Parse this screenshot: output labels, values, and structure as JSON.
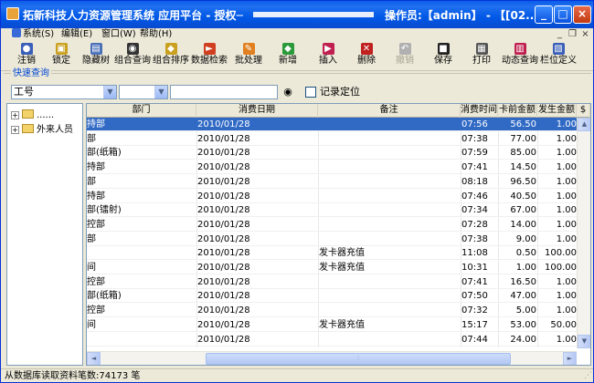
{
  "titlebar": {
    "title": "拓新科技人力资源管理系统 应用平台  - 授权─",
    "operator": "操作员:【admin】 - 【[02...",
    "controls": {
      "minimize": "_",
      "maximize": "□",
      "close": "×"
    }
  },
  "menubar": {
    "items": [
      {
        "label": "系统(S)"
      },
      {
        "label": "编辑(E)"
      },
      {
        "label": "窗口(W)"
      },
      {
        "label": "帮助(H)"
      }
    ],
    "mdi": {
      "minimize": "_",
      "restore": "❐",
      "close": "×"
    }
  },
  "toolbar": {
    "items": [
      {
        "label": "注销",
        "icon": "logout-icon",
        "glyph": "●",
        "color": "#3a5fb8"
      },
      {
        "label": "锁定",
        "icon": "lock-icon",
        "glyph": "▣",
        "color": "#c9a020"
      },
      {
        "label": "隐藏树",
        "icon": "hide-tree-icon",
        "glyph": "▤",
        "color": "#4a70b8"
      },
      {
        "label": "组合查询",
        "icon": "binoculars-icon",
        "glyph": "◉",
        "color": "#333333"
      },
      {
        "label": "组合排序",
        "icon": "sort-icon",
        "glyph": "◆",
        "color": "#c9a020"
      },
      {
        "label": "数据检索",
        "icon": "data-search-icon",
        "glyph": "►",
        "color": "#d04020"
      },
      {
        "label": "批处理",
        "icon": "batch-icon",
        "glyph": "✎",
        "color": "#e08020"
      },
      {
        "label": "新增",
        "icon": "add-icon",
        "glyph": "◆",
        "color": "#2a9a3a"
      },
      {
        "label": "插入",
        "icon": "insert-icon",
        "glyph": "▶",
        "color": "#c02050"
      },
      {
        "label": "删除",
        "icon": "delete-icon",
        "glyph": "✕",
        "color": "#c02020"
      },
      {
        "label": "撤销",
        "icon": "undo-icon",
        "glyph": "↶",
        "color": "#b0b0b0",
        "disabled": true
      },
      {
        "label": "保存",
        "icon": "save-icon",
        "glyph": "■",
        "color": "#222222"
      },
      {
        "label": "打印",
        "icon": "print-icon",
        "glyph": "▦",
        "color": "#555555"
      },
      {
        "label": "动态查询",
        "icon": "dynamic-query-icon",
        "glyph": "▥",
        "color": "#c02050"
      },
      {
        "label": "栏位定义",
        "icon": "column-define-icon",
        "glyph": "▧",
        "color": "#3a5fb8"
      }
    ]
  },
  "quick_query": {
    "legend": "快速查询",
    "field_select": "工号",
    "operator_select": "",
    "search_value": "",
    "record_locate_label": "记录定位"
  },
  "tree": {
    "nodes": [
      {
        "label": "......"
      },
      {
        "label": "外来人员"
      }
    ]
  },
  "grid": {
    "columns": {
      "dept": "部门",
      "date": "消费日期",
      "note": "备注",
      "time": "消费时间",
      "amt": "卡前金额",
      "cost": "发生金额",
      "extra": "$"
    },
    "rows": [
      {
        "dept": "持部",
        "date": "2010/01/28",
        "note": "",
        "time": "07:56",
        "amt": "56.50",
        "cost": "1.00",
        "selected": true
      },
      {
        "dept": "部",
        "date": "2010/01/28",
        "note": "",
        "time": "07:38",
        "amt": "77.00",
        "cost": "1.00"
      },
      {
        "dept": "部(纸箱)",
        "date": "2010/01/28",
        "note": "",
        "time": "07:59",
        "amt": "85.00",
        "cost": "1.00"
      },
      {
        "dept": "持部",
        "date": "2010/01/28",
        "note": "",
        "time": "07:41",
        "amt": "14.50",
        "cost": "1.00"
      },
      {
        "dept": "部",
        "date": "2010/01/28",
        "note": "",
        "time": "08:18",
        "amt": "96.50",
        "cost": "1.00"
      },
      {
        "dept": "持部",
        "date": "2010/01/28",
        "note": "",
        "time": "07:46",
        "amt": "40.50",
        "cost": "1.00"
      },
      {
        "dept": "部(镭射)",
        "date": "2010/01/28",
        "note": "",
        "time": "07:34",
        "amt": "67.00",
        "cost": "1.00"
      },
      {
        "dept": "控部",
        "date": "2010/01/28",
        "note": "",
        "time": "07:28",
        "amt": "14.00",
        "cost": "1.00"
      },
      {
        "dept": "部",
        "date": "2010/01/28",
        "note": "",
        "time": "07:38",
        "amt": "9.00",
        "cost": "1.00"
      },
      {
        "dept": "",
        "date": "2010/01/28",
        "note": "发卡器充值",
        "time": "11:08",
        "amt": "0.50",
        "cost": "100.00"
      },
      {
        "dept": "间",
        "date": "2010/01/28",
        "note": "发卡器充值",
        "time": "10:31",
        "amt": "1.00",
        "cost": "100.00"
      },
      {
        "dept": "控部",
        "date": "2010/01/28",
        "note": "",
        "time": "07:41",
        "amt": "16.50",
        "cost": "1.00"
      },
      {
        "dept": "部(纸箱)",
        "date": "2010/01/28",
        "note": "",
        "time": "07:50",
        "amt": "47.00",
        "cost": "1.00"
      },
      {
        "dept": "控部",
        "date": "2010/01/28",
        "note": "",
        "time": "07:32",
        "amt": "5.00",
        "cost": "1.00"
      },
      {
        "dept": "间",
        "date": "2010/01/28",
        "note": "发卡器充值",
        "time": "15:17",
        "amt": "53.00",
        "cost": "50.00"
      },
      {
        "dept": "",
        "date": "2010/01/28",
        "note": "",
        "time": "07:44",
        "amt": "24.00",
        "cost": "1.00"
      }
    ]
  },
  "statusbar": {
    "text": "从数据库读取资料笔数:74173 笔"
  }
}
